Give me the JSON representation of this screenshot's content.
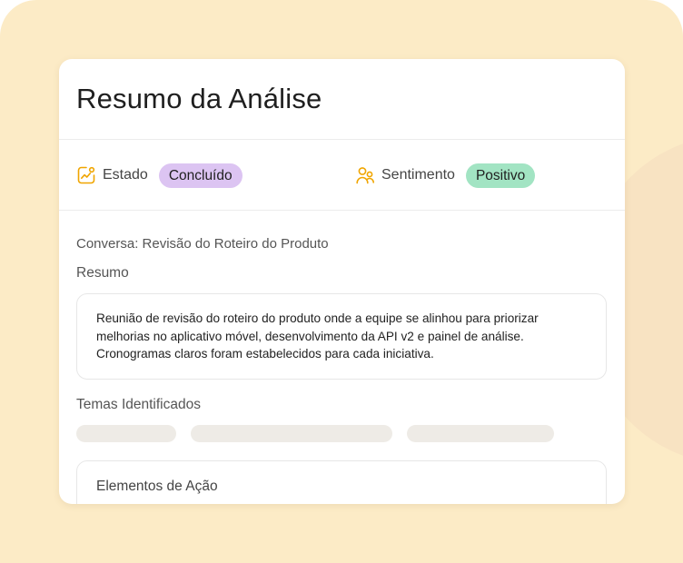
{
  "header": {
    "title": "Resumo da Análise"
  },
  "meta": {
    "status_label": "Estado",
    "status_value": "Concluído",
    "sentiment_label": "Sentimento",
    "sentiment_value": "Positivo",
    "status_icon": "chart-trend-icon",
    "sentiment_icon": "users-icon"
  },
  "conversation": {
    "line": "Conversa: Revisão do Roteiro do Produto"
  },
  "summary": {
    "label": "Resumo",
    "lines": [
      "Reunião de revisão do roteiro do produto onde a equipe se alinhou para priorizar",
      "melhorias no aplicativo móvel, desenvolvimento da API v2 e painel de análise.",
      "Cronogramas claros foram estabelecidos para cada iniciativa."
    ]
  },
  "themes": {
    "label": "Temas Identificados"
  },
  "actions": {
    "label": "Elementos de Ação"
  },
  "colors": {
    "backdrop": "#fcebc6",
    "badge_done": "#dcc4f2",
    "badge_positive": "#a2e4c3",
    "icon_accent": "#f0a500",
    "skeleton": "#eeebe6"
  }
}
